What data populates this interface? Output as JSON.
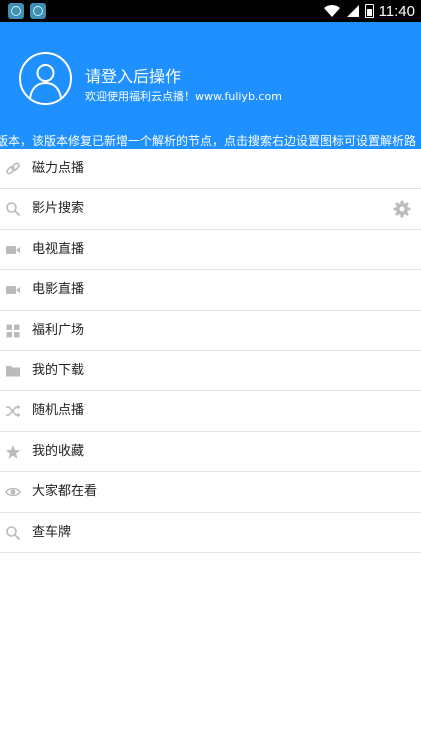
{
  "status_bar": {
    "time": "11:40",
    "icons": [
      "app-notification-icon",
      "app-notification-icon",
      "wifi-icon",
      "signal-icon",
      "battery-icon"
    ]
  },
  "header": {
    "login_title": "请登入后操作",
    "welcome_text": "欢迎使用福利云点播！www.fuliyb.com",
    "background_color": "#1e90ff"
  },
  "notice": {
    "text": "版本，该版本修复已新增一个解析的节点，点击搜索右边设置图标可设置解析路"
  },
  "menu": {
    "items": [
      {
        "label": "磁力点播",
        "icon": "link-icon"
      },
      {
        "label": "影片搜索",
        "icon": "search-icon",
        "trailing_icon": "gear-icon"
      },
      {
        "label": "电视直播",
        "icon": "video-camera-icon"
      },
      {
        "label": "电影直播",
        "icon": "video-camera-icon"
      },
      {
        "label": "福利广场",
        "icon": "grid-icon"
      },
      {
        "label": "我的下载",
        "icon": "folder-icon"
      },
      {
        "label": "随机点播",
        "icon": "shuffle-icon"
      },
      {
        "label": "我的收藏",
        "icon": "star-icon"
      },
      {
        "label": "大家都在看",
        "icon": "eye-icon"
      },
      {
        "label": "查车牌",
        "icon": "search-icon"
      }
    ]
  }
}
